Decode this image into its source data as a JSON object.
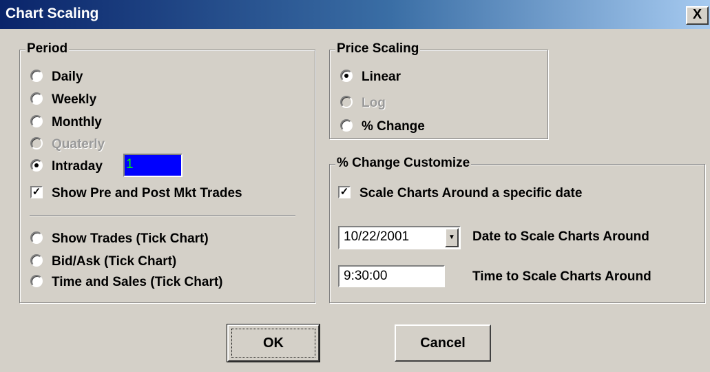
{
  "window": {
    "title": "Chart Scaling",
    "close_label": "X"
  },
  "period": {
    "legend": "Period",
    "options": [
      {
        "label": "Daily",
        "selected": false,
        "enabled": true
      },
      {
        "label": "Weekly",
        "selected": false,
        "enabled": true
      },
      {
        "label": "Monthly",
        "selected": false,
        "enabled": true
      },
      {
        "label": "Quaterly",
        "selected": false,
        "enabled": false
      },
      {
        "label": "Intraday",
        "selected": true,
        "enabled": true
      }
    ],
    "intraday_value": "1",
    "pre_post_label": "Show Pre and Post Mkt Trades",
    "pre_post_checked": true,
    "tick_options": [
      {
        "label": "Show Trades (Tick Chart)",
        "selected": false
      },
      {
        "label": "Bid/Ask (Tick Chart)",
        "selected": false
      },
      {
        "label": "Time and Sales (Tick Chart)",
        "selected": false
      }
    ]
  },
  "price_scaling": {
    "legend": "Price Scaling",
    "options": [
      {
        "label": "Linear",
        "selected": true,
        "enabled": true
      },
      {
        "label": "Log",
        "selected": false,
        "enabled": false
      },
      {
        "label": "% Change",
        "selected": false,
        "enabled": true
      }
    ]
  },
  "pct_change": {
    "legend": "% Change Customize",
    "scale_label": "Scale Charts Around a specific date",
    "scale_checked": true,
    "date_value": "10/22/2001",
    "date_label": "Date to Scale Charts Around",
    "time_value": "9:30:00",
    "time_label": "Time to Scale Charts Around"
  },
  "buttons": {
    "ok": "OK",
    "cancel": "Cancel"
  },
  "icons": {
    "check": "✓",
    "dropdown": "▼"
  }
}
